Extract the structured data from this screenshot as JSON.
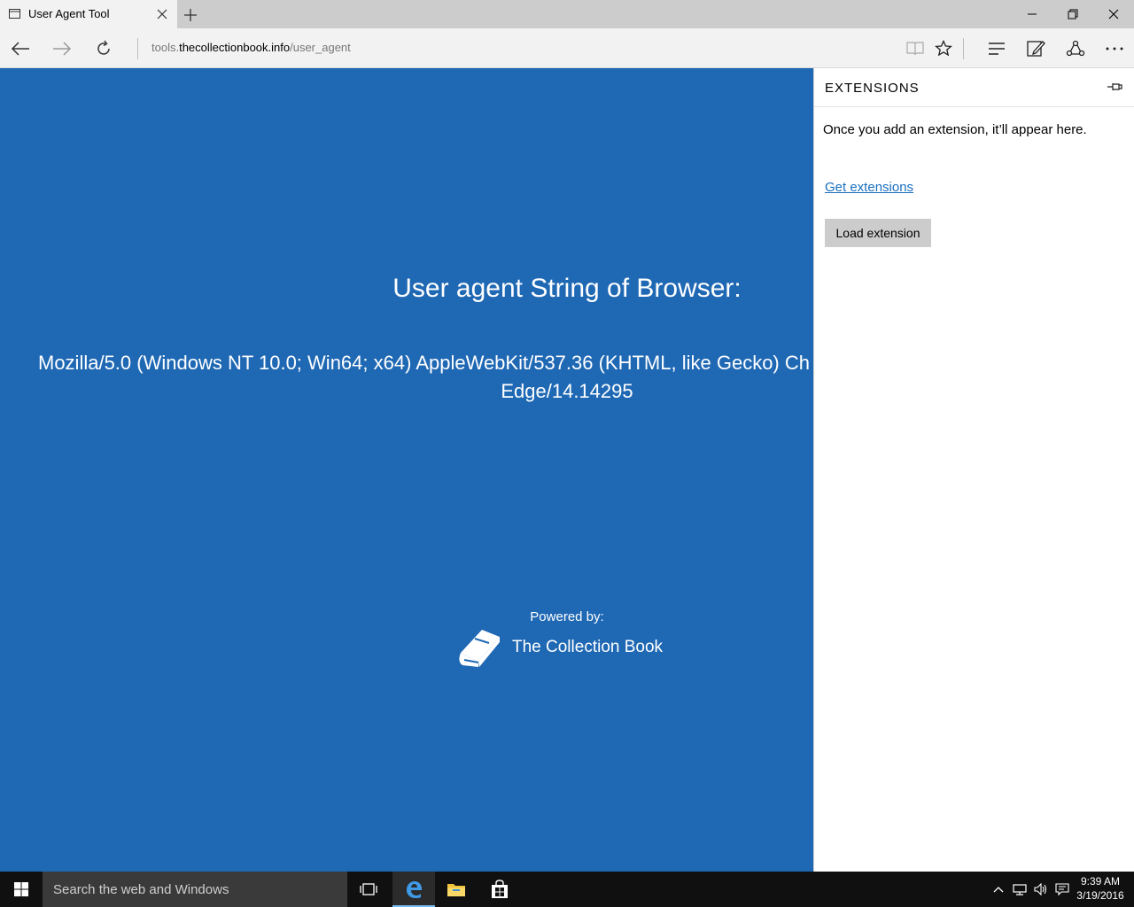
{
  "browser": {
    "tab_title": "User Agent Tool",
    "address": {
      "prefix": "tools.",
      "host": "thecollectionbook.info",
      "path": "/user_agent"
    }
  },
  "page": {
    "heading": "User agent String of Browser:",
    "ua_line1": "Mozilla/5.0 (Windows NT 10.0; Win64; x64) AppleWebKit/537.36 (KHTML, like Gecko) Ch",
    "ua_line2": "Edge/14.14295",
    "powered_by": "Powered by:",
    "brand_name": "The Collection Book",
    "background_color": "#1f68b4"
  },
  "extensions_pane": {
    "title": "EXTENSIONS",
    "message": "Once you add an extension, it’ll appear here.",
    "get_extensions_link": "Get extensions",
    "load_button": "Load extension"
  },
  "taskbar": {
    "search_placeholder": "Search the web and Windows",
    "time": "9:39 AM",
    "date": "3/19/2016"
  }
}
